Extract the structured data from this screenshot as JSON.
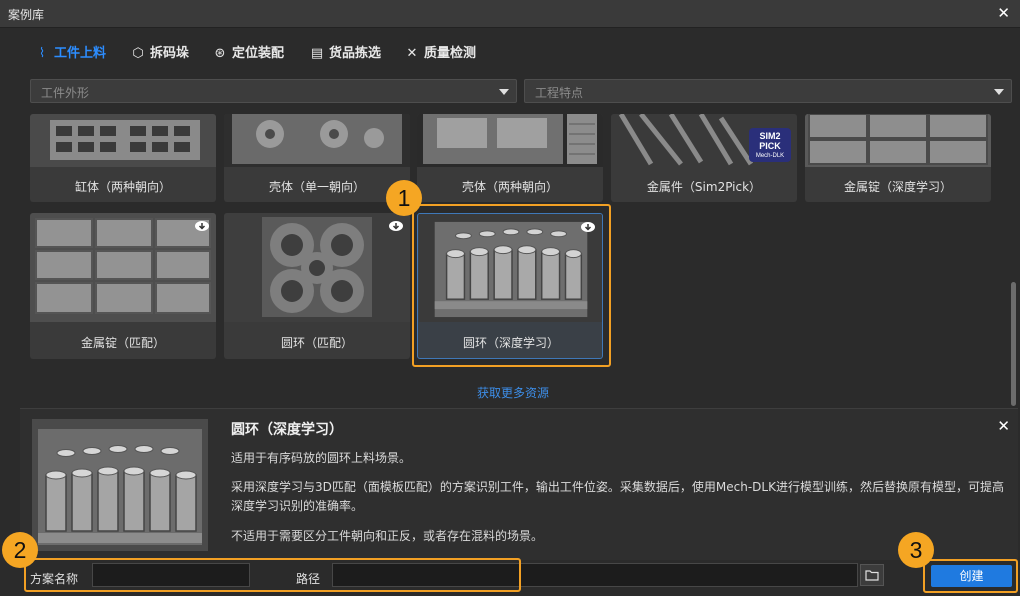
{
  "window": {
    "title": "案例库",
    "close_glyph": "✕"
  },
  "tabs": [
    {
      "label": "工件上料",
      "icon": "feeding-icon",
      "active": true
    },
    {
      "label": "拆码垛",
      "icon": "cube-icon",
      "active": false
    },
    {
      "label": "定位装配",
      "icon": "target-icon",
      "active": false
    },
    {
      "label": "货品拣选",
      "icon": "box-icon",
      "active": false
    },
    {
      "label": "质量检测",
      "icon": "tools-icon",
      "active": false
    }
  ],
  "filters": {
    "shape_placeholder": "工件外形",
    "feature_placeholder": "工程特点"
  },
  "cases_row1": [
    {
      "label": "缸体（两种朝向）"
    },
    {
      "label": "壳体（单一朝向）"
    },
    {
      "label": "壳体（两种朝向）"
    },
    {
      "label": "金属件（Sim2Pick）"
    },
    {
      "label": "金属锭（深度学习）"
    }
  ],
  "cases_row2": [
    {
      "label": "金属锭（匹配）",
      "downloadable": true
    },
    {
      "label": "圆环（匹配）",
      "downloadable": true
    },
    {
      "label": "圆环（深度学习）",
      "downloadable": true,
      "selected": true
    }
  ],
  "sim2pick_badge": [
    "SIM2",
    "PICK",
    "Mech-DLK"
  ],
  "more_link": "获取更多资源",
  "detail": {
    "title": "圆环（深度学习）",
    "p1": "适用于有序码放的圆环上料场景。",
    "p2": "采用深度学习与3D匹配（面模板匹配）的方案识别工件，输出工件位姿。采集数据后，使用Mech-DLK进行模型训练，然后替换原有模型，可提高深度学习识别的准确率。",
    "p3": "不适用于需要区分工件朝向和正反，或者存在混料的场景。"
  },
  "footer": {
    "name_label": "方案名称",
    "name_value": "",
    "path_label": "路径",
    "path_value": "",
    "create_label": "创建"
  },
  "callouts": [
    "1",
    "2",
    "3"
  ],
  "colors": {
    "accent": "#2c8dff",
    "callout": "#f5a623",
    "primary_button": "#1f7ae0"
  }
}
